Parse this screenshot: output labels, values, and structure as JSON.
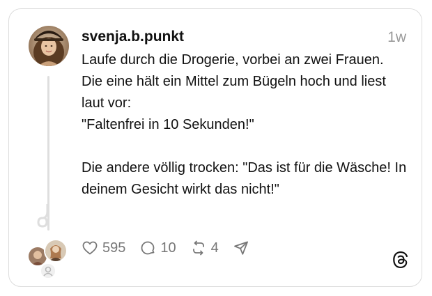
{
  "post": {
    "username": "svenja.b.punkt",
    "timestamp": "1w",
    "lines": [
      "Laufe durch die Drogerie, vorbei an zwei Frauen.",
      "Die eine hält ein Mittel zum Bügeln hoch und liest laut vor:",
      "\"Faltenfrei in 10 Sekunden!\"",
      "",
      "Die andere völlig trocken: \"Das ist für die Wäsche! In deinem Gesicht wirkt das nicht!\""
    ]
  },
  "actions": {
    "likes": "595",
    "replies": "10",
    "reposts": "4",
    "icons": [
      "heart-icon",
      "comment-icon",
      "repost-icon",
      "share-icon"
    ]
  },
  "colors": {
    "border": "#dcdcdc",
    "muted": "#777777",
    "timestamp": "#9a9a9a",
    "thread_line": "#dedede"
  },
  "branding": {
    "logo": "threads-logo"
  }
}
